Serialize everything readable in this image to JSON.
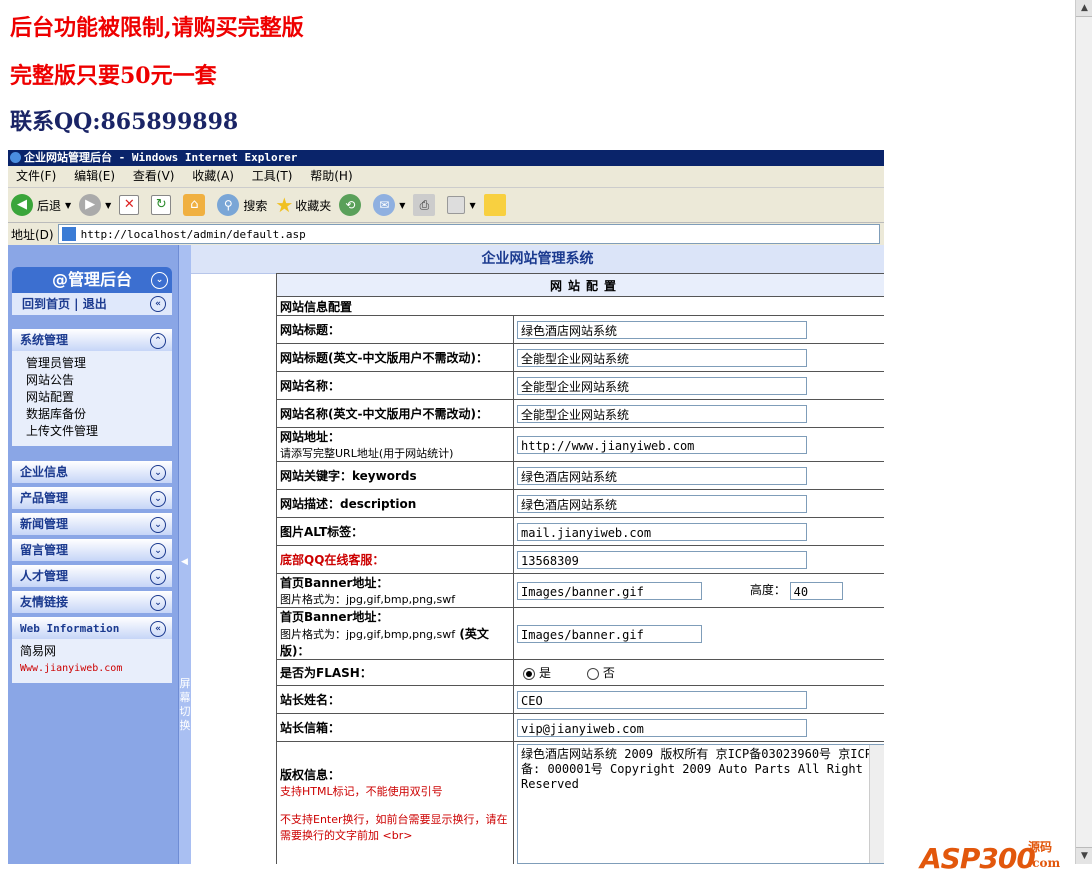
{
  "notices": [
    "后台功能被限制,请购买完整版",
    "完整版只要50元一套",
    "联系QQ:865899898"
  ],
  "window": {
    "title": "企业网站管理后台 - Windows Internet Explorer",
    "menu": [
      "文件(F)",
      "编辑(E)",
      "查看(V)",
      "收藏(A)",
      "工具(T)",
      "帮助(H)"
    ],
    "toolbar": {
      "back": "后退",
      "search": "搜索",
      "favorites": "收藏夹"
    },
    "address_label": "地址(D)",
    "address": "http://localhost/admin/default.asp"
  },
  "sidebar": {
    "header": "@管理后台",
    "sub": "回到首页 | 退出",
    "panels": [
      {
        "title": "系统管理",
        "items": [
          "管理员管理",
          "网站公告",
          "网站配置",
          "数据库备份",
          "上传文件管理"
        ]
      }
    ],
    "sections": [
      "企业信息",
      "产品管理",
      "新闻管理",
      "留言管理",
      "人才管理",
      "友情链接"
    ],
    "web_info": {
      "title": "Web Information",
      "line1": "简易网",
      "line2": "Www.jianyiweb.com"
    },
    "splitter_label": "屏幕切换"
  },
  "main": {
    "title": "企业网站管理系统",
    "table_header": "网站配置",
    "section": "网站信息配置",
    "rows": [
      {
        "label": "网站标题：",
        "value": "绿色酒店网站系统"
      },
      {
        "label": "网站标题(英文-中文版用户不需改动)：",
        "value": "全能型企业网站系统"
      },
      {
        "label": "网站名称：",
        "value": "全能型企业网站系统"
      },
      {
        "label": "网站名称(英文-中文版用户不需改动)：",
        "value": "全能型企业网站系统"
      },
      {
        "label": "网站地址：",
        "note": "请添写完整URL地址(用于网站统计)",
        "value": "http://www.jianyiweb.com"
      },
      {
        "label": "网站关键字：keywords",
        "value": "绿色酒店网站系统"
      },
      {
        "label": "网站描述：description",
        "value": "绿色酒店网站系统"
      },
      {
        "label": "图片ALT标签：",
        "value": "mail.jianyiweb.com"
      },
      {
        "label": "底部QQ在线客服：",
        "value": "13568309"
      }
    ],
    "banner": {
      "label": "首页Banner地址：",
      "note": "图片格式为：jpg,gif,bmp,png,swf",
      "value": "Images/banner.gif",
      "height_label": "高度：",
      "height": "40"
    },
    "banner_en": {
      "label": "首页Banner地址：",
      "note": "图片格式为：jpg,gif,bmp,png,swf",
      "note2": "(英文版)：",
      "value": "Images/banner.gif"
    },
    "flash": {
      "label": "是否为FLASH：",
      "yes": "是",
      "no": "否"
    },
    "owner": {
      "label": "站长姓名：",
      "value": "CEO"
    },
    "email": {
      "label": "站长信箱：",
      "value": "vip@jianyiweb.com"
    },
    "copyright": {
      "label": "版权信息：",
      "note1": "支持HTML标记，不能使用双引号",
      "note2": "不支持Enter换行，如前台需要显示换行，请在需要换行的文字前加 <br>",
      "value": "绿色酒店网站系统 2009 版权所有 京ICP备03023960号 京ICP备: 000001号 Copyright 2009 Auto Parts All Right Reserved"
    }
  },
  "watermark": {
    "brand": "ASP300",
    "suffix_cn": "源码",
    "suffix_com": ".com"
  }
}
